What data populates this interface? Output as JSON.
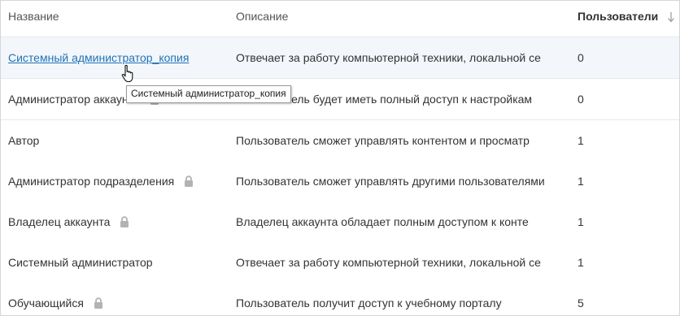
{
  "table": {
    "columns": {
      "name": "Название",
      "description": "Описание",
      "users": "Пользователи"
    },
    "rows": [
      {
        "name": "Системный администратор_копия",
        "description": "Отвечает за работу компьютерной техники, локальной се",
        "users": "0",
        "locked": false,
        "link": true
      },
      {
        "name": "Администратор аккаунта",
        "description": "Пользователь будет иметь полный доступ к настройкам",
        "users": "0",
        "locked": true,
        "link": false
      },
      {
        "name": "Автор",
        "description": "Пользователь сможет управлять контентом и просматр",
        "users": "1",
        "locked": false,
        "link": false
      },
      {
        "name": "Администратор подразделения",
        "description": "Пользователь сможет управлять другими пользователями",
        "users": "1",
        "locked": true,
        "link": false
      },
      {
        "name": "Владелец аккаунта",
        "description": "Владелец аккаунта обладает полным доступом к конте",
        "users": "1",
        "locked": true,
        "link": false
      },
      {
        "name": "Системный администратор",
        "description": "Отвечает за работу компьютерной техники, локальной се",
        "users": "1",
        "locked": false,
        "link": false
      },
      {
        "name": "Обучающийся",
        "description": "Пользователь получит доступ к учебному порталу",
        "users": "5",
        "locked": true,
        "link": false
      }
    ]
  },
  "tooltip": {
    "text": "Системный администратор_копия"
  },
  "icons": {
    "lock": "lock-icon",
    "sort": "sort-down-arrow-icon",
    "cursor": "hand-pointer-cursor-icon"
  },
  "colors": {
    "link": "#1f73b7",
    "hover_row": "#f3f7fb",
    "lock": "#b3b3b3"
  }
}
